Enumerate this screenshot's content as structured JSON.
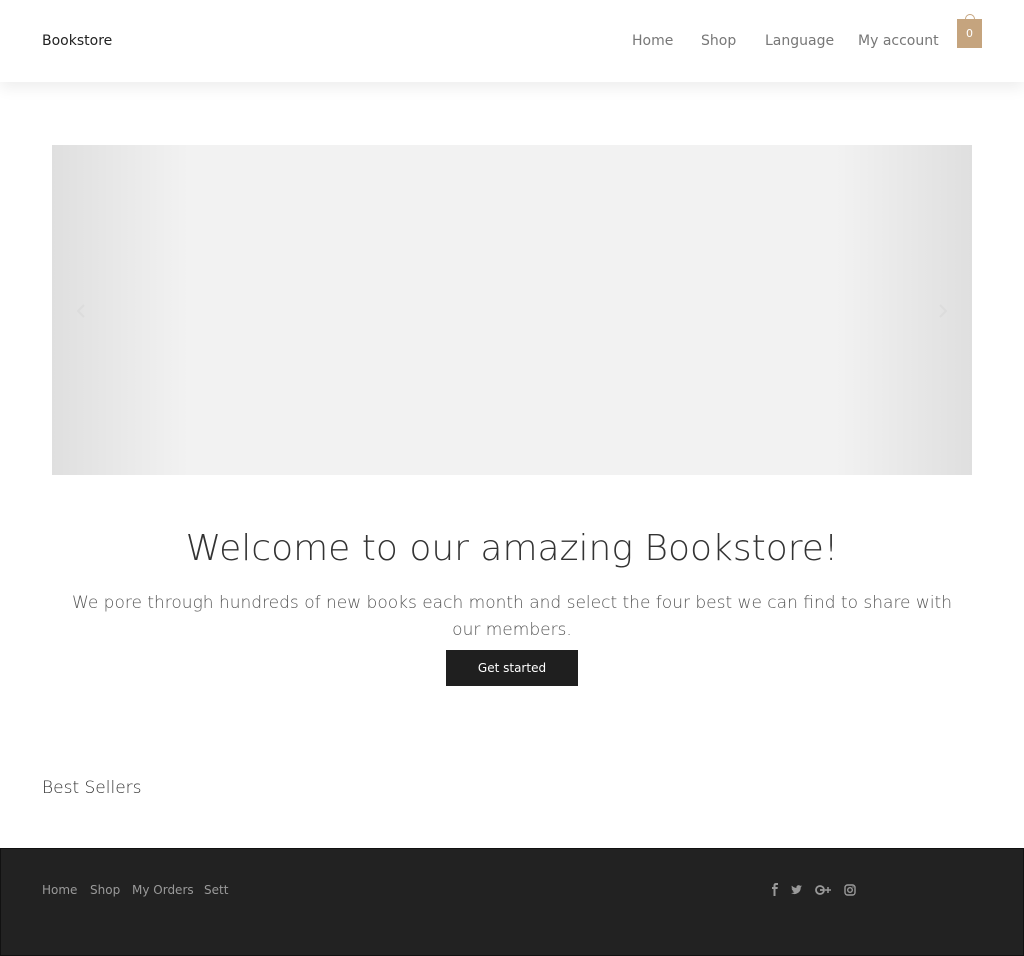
{
  "header": {
    "brand": "Bookstore",
    "nav": [
      "Home",
      "Shop",
      "Language",
      "My account"
    ],
    "cart_count": "0",
    "cart_color": "#c5a47e"
  },
  "slider": {
    "prev_icon": "chevron-left-icon",
    "next_icon": "chevron-right-icon"
  },
  "hero": {
    "title": "Welcome to our amazing Bookstore!",
    "subtitle": "We pore through hundreds of new books each month and select the four best we can find to share with our members.",
    "button": "Get started"
  },
  "sections": {
    "best_sellers": "Best Sellers"
  },
  "footer": {
    "links": [
      "Home",
      "Shop",
      "My Orders",
      "Sett"
    ],
    "social_icons": [
      "facebook-icon",
      "twitter-icon",
      "google-plus-icon",
      "instagram-icon"
    ],
    "background": "#222222"
  }
}
